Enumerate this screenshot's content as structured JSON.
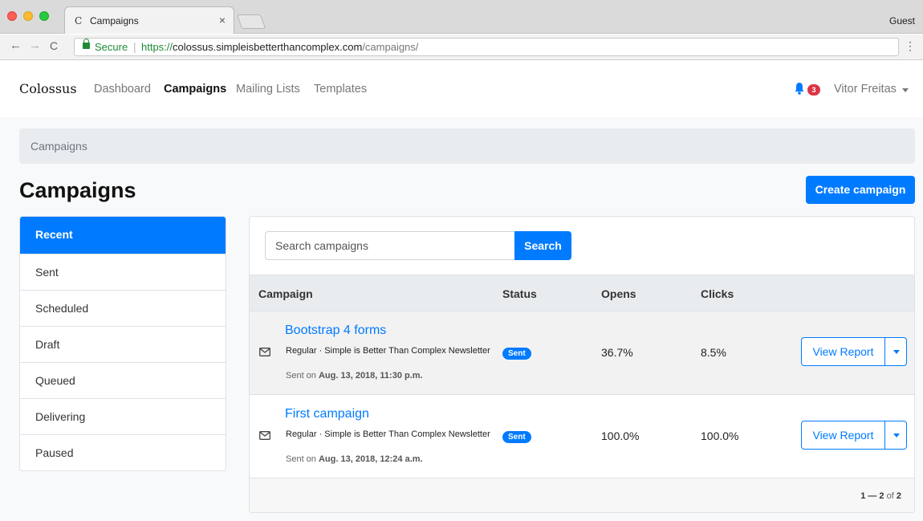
{
  "browser": {
    "tab_favicon": "C",
    "tab_title": "Campaigns",
    "tab_close": "×",
    "profile": "Guest",
    "back": "←",
    "forward": "→",
    "reload": "C",
    "secure_label": "Secure",
    "url_protocol": "https://",
    "url_host": "colossus.simpleisbetterthancomplex.com",
    "url_path": "/campaigns/",
    "menu": "⋮"
  },
  "nav": {
    "brand": "Colossus",
    "links": [
      "Dashboard",
      "Campaigns",
      "Mailing Lists",
      "Templates"
    ],
    "active": "Campaigns",
    "notifications": "3",
    "user": "Vitor Freitas"
  },
  "breadcrumb": "Campaigns",
  "page_title": "Campaigns",
  "create_button": "Create campaign",
  "sidebar": {
    "items": [
      "Recent",
      "Sent",
      "Scheduled",
      "Draft",
      "Queued",
      "Delivering",
      "Paused"
    ],
    "active": "Recent"
  },
  "search": {
    "placeholder": "Search campaigns",
    "button": "Search"
  },
  "table": {
    "headers": [
      "Campaign",
      "Status",
      "Opens",
      "Clicks"
    ],
    "rows": [
      {
        "title": "Bootstrap 4 forms",
        "meta": "Regular  ·  Simple is Better Than Complex Newsletter",
        "sent_prefix": "Sent on",
        "sent_date": "Aug. 13, 2018, 11:30 p.m.",
        "status": "Sent",
        "opens": "36.7%",
        "clicks": "8.5%",
        "action": "View Report"
      },
      {
        "title": "First campaign",
        "meta": "Regular  ·  Simple is Better Than Complex Newsletter",
        "sent_prefix": "Sent on",
        "sent_date": "Aug. 13, 2018, 12:24 a.m.",
        "status": "Sent",
        "opens": "100.0%",
        "clicks": "100.0%",
        "action": "View Report"
      }
    ]
  },
  "pagination": {
    "range": "1 — 2",
    "of_label": "of",
    "total": "2"
  },
  "colors": {
    "primary": "#007bff",
    "badge_danger": "#dc3545",
    "secure_green": "#1e8a37"
  }
}
